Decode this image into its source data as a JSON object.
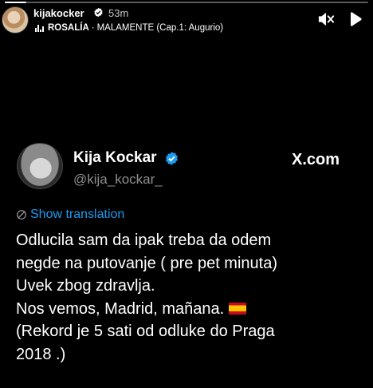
{
  "story": {
    "progress": 0.06,
    "username": "kijakocker",
    "time": "53m",
    "music": {
      "artist": "ROSALÍA",
      "separator": "·",
      "song": "MALAMENTE (Cap.1: Augurio)"
    },
    "icons": {
      "avatar": "profile-photo",
      "verified": "verified-badge-icon",
      "music": "equalizer-icon",
      "mute": "speaker-muted-icon",
      "play": "play-icon"
    }
  },
  "tweet": {
    "name": "Kija Kockar",
    "handle": "@kija_kockar_",
    "brand": "X.com",
    "translation_label": "Show translation",
    "lines": [
      "Odlucila sam da ipak treba da odem",
      "negde na putovanje ( pre pet minuta)",
      "Uvek zbog zdravlja.",
      "Nos vemos, Madrid, mañana.",
      "(Rekord je 5 sati od odluke do Praga",
      "2018 .)"
    ],
    "flag_emoji": "spain-flag",
    "colors": {
      "verified": "#1d9bf0",
      "link": "#1d9bf0",
      "handle": "#8e8e8e"
    }
  }
}
